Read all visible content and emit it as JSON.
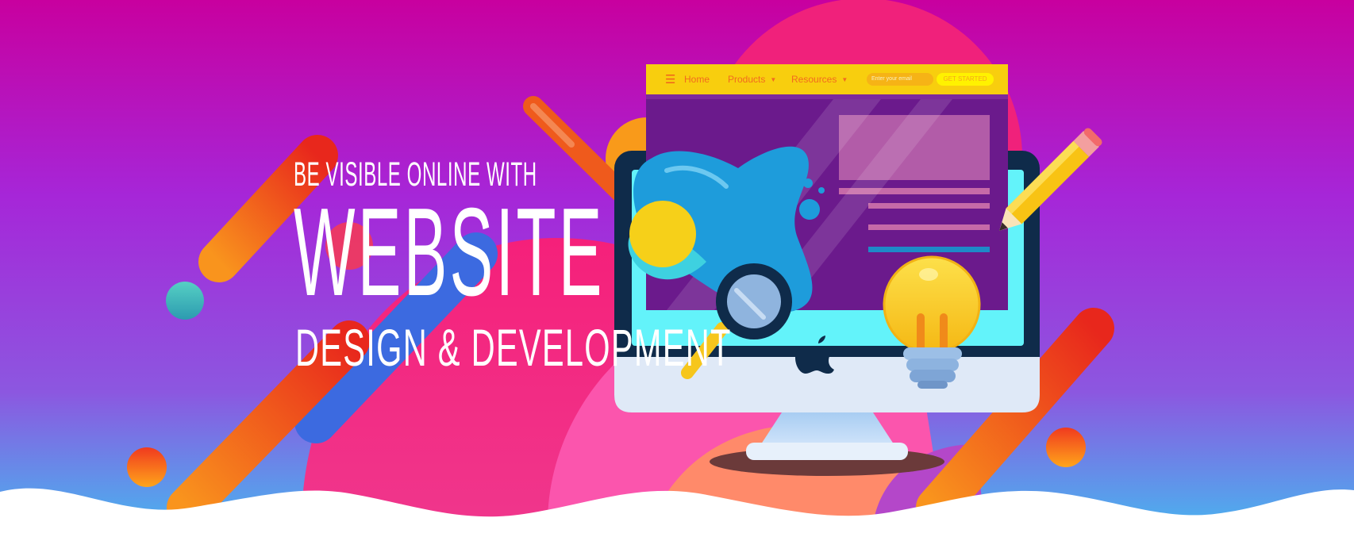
{
  "hero": {
    "kicker": "BE VISIBLE ONLINE WITH",
    "title": "WEBSITE",
    "subtitle": "DESIGN & DEVELOPMENT"
  },
  "mock_site": {
    "menu_icon": "hamburger-icon",
    "nav_items": [
      "Home",
      "Products",
      "Resources"
    ],
    "email_placeholder": "Enter your email",
    "cta_label": "GET STARTED"
  },
  "icons": [
    "apple-logo-icon",
    "magnifying-glass-icon",
    "pencil-icon",
    "light-bulb-icon",
    "paint-splash-icon"
  ],
  "colors": {
    "gradient_top": "#c8009f",
    "gradient_mid": "#a52ad9",
    "gradient_bottom": "#3bc7f2",
    "accent_pink": "#f5217b",
    "accent_orange": "#f57a1d",
    "nav_yellow": "#f8ce0e",
    "screen_purple": "#6b1a8c"
  }
}
